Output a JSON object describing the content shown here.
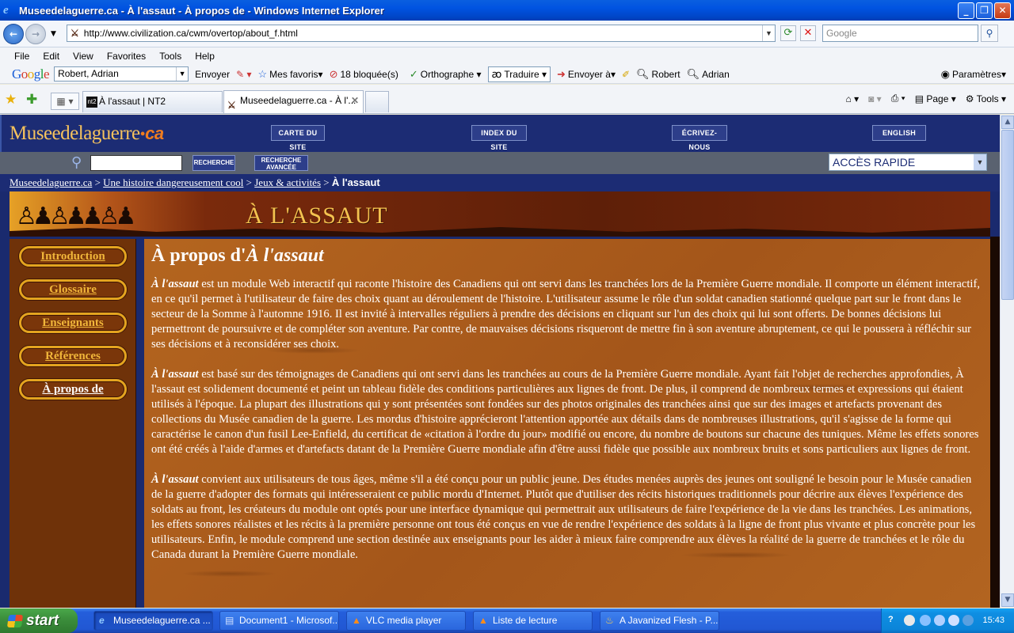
{
  "window": {
    "title": "Museedelaguerre.ca - À l'assaut - À propos de - Windows Internet Explorer"
  },
  "address": {
    "url": "http://www.civilization.ca/cwm/overtop/about_f.html",
    "search_placeholder": "Google"
  },
  "menu": [
    "File",
    "Edit",
    "View",
    "Favorites",
    "Tools",
    "Help"
  ],
  "google_toolbar": {
    "account": "Robert, Adrian",
    "envoyer": "Envoyer",
    "mes_favoris": "Mes favoris",
    "bloquees": "18 bloquée(s)",
    "orthographe": "Orthographe",
    "traduire": "Traduire",
    "envoyer_a": "Envoyer à",
    "robert": "Robert",
    "adrian": "Adrian",
    "parametres": "Paramètres"
  },
  "tabs": [
    {
      "label": "À l'assaut | NT2"
    },
    {
      "label": "Museedelaguerre.ca - À l'..."
    }
  ],
  "command_bar": {
    "page": "Page",
    "tools": "Tools"
  },
  "site": {
    "logo": "Museedelaguerre",
    "logo_suffix": "ca",
    "header_buttons": [
      "CARTE DU SITE",
      "INDEX DU SITE",
      "ÉCRIVEZ-NOUS",
      "ENGLISH"
    ],
    "search_button": "RECHERCHE",
    "advanced_button_1": "RECHERCHE",
    "advanced_button_2": "AVANCÉE",
    "quick_access": "ACCÈS RAPIDE"
  },
  "breadcrumb": {
    "items": [
      "Museedelaguerre.ca",
      "Une histoire dangereusement cool",
      "Jeux & activités"
    ],
    "current": "À l'assaut"
  },
  "banner": {
    "title": "À L'ASSAUT"
  },
  "sidebar": {
    "items": [
      "Introduction",
      "Glossaire",
      "Enseignants",
      "Références",
      "À propos de"
    ]
  },
  "content": {
    "heading_prefix": "À propos d'",
    "heading_italic": "À l'assaut",
    "paragraphs": [
      {
        "lead": "À l'assaut",
        "text": " est un module Web interactif qui raconte l'histoire des Canadiens qui ont servi dans les tranchées lors de la Première Guerre mondiale. Il comporte un élément interactif, en ce qu'il permet à l'utilisateur de faire des choix quant au déroulement de l'histoire. L'utilisateur assume le rôle d'un soldat canadien stationné quelque part sur le front dans le secteur de la Somme à l'automne 1916. Il est invité à intervalles réguliers à prendre des décisions en cliquant sur l'un des choix qui lui sont offerts. De bonnes décisions lui permettront de poursuivre et de compléter son aventure. Par contre, de mauvaises décisions risqueront de mettre fin à son aventure abruptement, ce qui le poussera à réfléchir sur ses décisions et à reconsidérer ses choix."
      },
      {
        "lead": "À l'assaut",
        "text": " est basé sur des témoignages de Canadiens qui ont servi dans les tranchées au cours de la Première Guerre mondiale. Ayant fait l'objet de recherches approfondies, À l'assaut est solidement documenté et peint un tableau fidèle des conditions particulières aux lignes de front. De plus, il comprend de nombreux termes et expressions qui étaient utilisés à l'époque. La plupart des illustrations qui y sont présentées sont fondées sur des photos originales des tranchées ainsi que sur des images et artefacts provenant des collections du Musée canadien de la guerre. Les mordus d'histoire apprécieront l'attention apportée aux détails dans de nombreuses illustrations, qu'il s'agisse de la forme qui caractérise le canon d'un fusil Lee-Enfield, du certificat de «citation à l'ordre du jour» modifié ou encore, du nombre de boutons sur chacune des tuniques. Même les effets sonores ont été créés à l'aide d'armes et d'artefacts datant de la Première Guerre mondiale afin d'être aussi fidèle que possible aux nombreux bruits et sons particuliers aux lignes de front."
      },
      {
        "lead": "À l'assaut",
        "text": " convient aux utilisateurs de tous âges, même s'il a été conçu pour un public jeune. Des études menées auprès des jeunes ont souligné le besoin pour le Musée canadien de la guerre d'adopter des formats qui intéresseraient ce public mordu d'Internet. Plutôt que d'utiliser des récits historiques traditionnels pour décrire aux élèves l'expérience des soldats au front, les créateurs du module ont optés pour une interface dynamique qui permettrait aux utilisateurs de faire l'expérience de la vie dans les tranchées. Les animations, les effets sonores réalistes et les récits à la première personne ont tous été conçus en vue de rendre l'expérience des soldats à la ligne de front plus vivante et plus concrète pour les utilisateurs. Enfin, le module comprend une section destinée aux enseignants pour les aider à mieux faire comprendre aux élèves la réalité de la guerre de tranchées et le rôle du Canada durant la Première Guerre mondiale."
      }
    ]
  },
  "taskbar": {
    "start": "start",
    "tasks": [
      "Museedelaguerre.ca ...",
      "Document1 - Microsof...",
      "VLC media player",
      "Liste de lecture",
      "A Javanized Flesh - P..."
    ],
    "clock": "15:43"
  },
  "colors": {
    "accent": "#1c2c74",
    "brown": "#a4561a",
    "gold": "#f1b63a"
  }
}
